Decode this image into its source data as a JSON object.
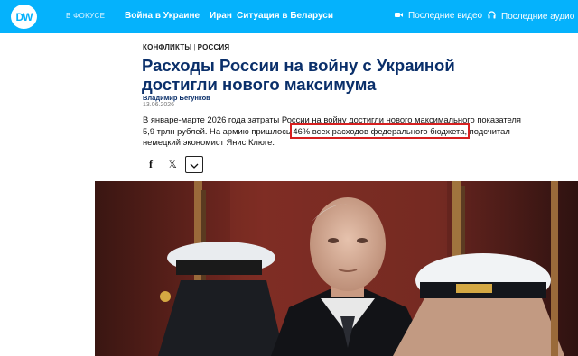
{
  "brand": {
    "logo_text": "DW",
    "color": "#05b2fc"
  },
  "nav": {
    "focus_label": "В ФОКУСЕ",
    "links": [
      "Война в Украине",
      "Иран",
      "Ситуация в Беларуси"
    ],
    "latest_video": "Последние видео",
    "latest_audio": "Последние аудио",
    "video_icon": "video-camera-icon",
    "audio_icon": "headphones-icon"
  },
  "article": {
    "kicker_1": "КОНФЛИКТЫ",
    "kicker_sep": "|",
    "kicker_2": "РОССИЯ",
    "title": "Расходы России на войну с Украиной достигли нового максимума",
    "author": "Владимир Бегунков",
    "date": "13.06.2026",
    "lead_before": "В январе-марте 2026 года затраты России на войну достигли нового максимального показателя 5,9 трлн рублей. На армию пришлось ",
    "lead_highlight": "46% всех расходов федерального бюджета,",
    "lead_after": " подсчитал немецкий экономист Янис Клюге.",
    "highlight_color": "#d62020",
    "title_color": "#0a2f6a"
  },
  "share": {
    "facebook": "f",
    "x": "𝕏",
    "more": "⌄"
  }
}
